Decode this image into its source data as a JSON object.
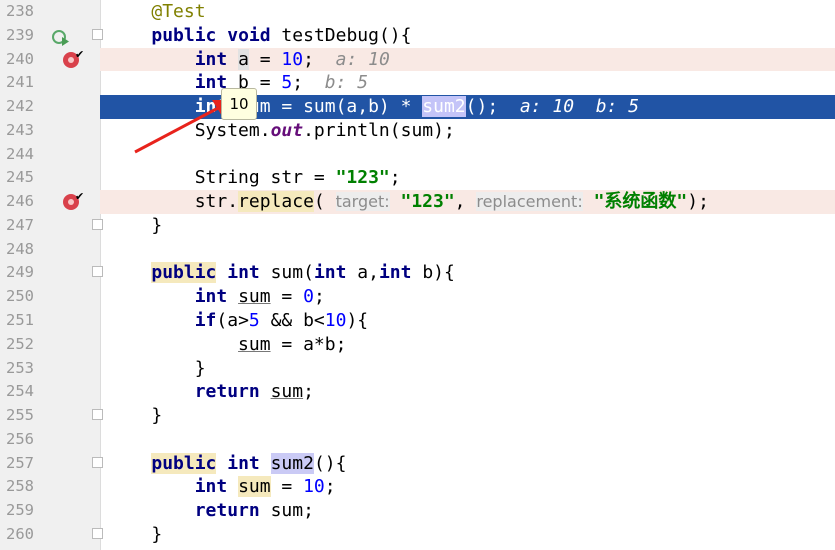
{
  "editor": {
    "lines": [
      {
        "n": "238",
        "tokens": [
          [
            "    "
          ],
          [
            "@Test",
            "ann"
          ]
        ]
      },
      {
        "n": "239",
        "tokens": [
          [
            "    "
          ],
          [
            "public",
            "kw"
          ],
          [
            " "
          ],
          [
            "void",
            "kw"
          ],
          [
            " testDebug(){"
          ]
        ],
        "run": true,
        "fold": true
      },
      {
        "n": "240",
        "bg": "pink",
        "bp": true,
        "tokens": [
          [
            "        "
          ],
          [
            "int",
            "kw"
          ],
          [
            " "
          ],
          [
            "a",
            "hg"
          ],
          [
            " = "
          ],
          [
            "10",
            "num"
          ],
          [
            ";"
          ],
          [
            "  a: 10",
            "inl"
          ]
        ]
      },
      {
        "n": "241",
        "tokens": [
          [
            "        "
          ],
          [
            "int",
            "kw"
          ],
          [
            " b = "
          ],
          [
            "5",
            "num"
          ],
          [
            ";"
          ],
          [
            "  b: 5",
            "inl"
          ]
        ]
      },
      {
        "n": "242",
        "bg": "blue",
        "tokens": [
          [
            "        "
          ],
          [
            "int",
            "kw"
          ],
          [
            " sum = sum(a,b) * "
          ],
          [
            "sum2",
            "hl"
          ],
          [
            "();"
          ],
          [
            "  a: 10  b: 5",
            "inl"
          ]
        ]
      },
      {
        "n": "243",
        "tokens": [
          [
            "        System."
          ],
          [
            "out",
            "field"
          ],
          [
            ".println(sum);"
          ]
        ]
      },
      {
        "n": "244",
        "tokens": []
      },
      {
        "n": "245",
        "tokens": [
          [
            "        String str = "
          ],
          [
            "\"123\"",
            "str"
          ],
          [
            ";"
          ]
        ]
      },
      {
        "n": "246",
        "bg": "pink",
        "bp": true,
        "tokens": [
          [
            "        str."
          ],
          [
            "replace",
            "hy"
          ],
          [
            "( "
          ],
          [
            "target:",
            "hint"
          ],
          [
            " "
          ],
          [
            "\"123\"",
            "str"
          ],
          [
            ", "
          ],
          [
            "replacement:",
            "hint"
          ],
          [
            " "
          ],
          [
            "\"系统函数\"",
            "str"
          ],
          [
            ");"
          ]
        ]
      },
      {
        "n": "247",
        "tokens": [
          [
            "    }"
          ]
        ],
        "fold": true
      },
      {
        "n": "248",
        "tokens": []
      },
      {
        "n": "249",
        "tokens": [
          [
            "    "
          ],
          [
            "public",
            "kw hy"
          ],
          [
            " "
          ],
          [
            "int",
            "kw"
          ],
          [
            " sum("
          ],
          [
            "int",
            "kw"
          ],
          [
            " a,"
          ],
          [
            "int",
            "kw"
          ],
          [
            " b){"
          ]
        ],
        "fold": true
      },
      {
        "n": "250",
        "tokens": [
          [
            "        "
          ],
          [
            "int",
            "kw"
          ],
          [
            " "
          ],
          [
            "sum",
            "ul"
          ],
          [
            " = "
          ],
          [
            "0",
            "num"
          ],
          [
            ";"
          ]
        ]
      },
      {
        "n": "251",
        "tokens": [
          [
            "        "
          ],
          [
            "if",
            "kw"
          ],
          [
            "(a>"
          ],
          [
            "5",
            "num"
          ],
          [
            " && b<"
          ],
          [
            "10",
            "num"
          ],
          [
            "){"
          ]
        ]
      },
      {
        "n": "252",
        "tokens": [
          [
            "            "
          ],
          [
            "sum",
            "ul"
          ],
          [
            " = a*b;"
          ]
        ]
      },
      {
        "n": "253",
        "tokens": [
          [
            "        }"
          ]
        ]
      },
      {
        "n": "254",
        "tokens": [
          [
            "        "
          ],
          [
            "return",
            "kw"
          ],
          [
            " "
          ],
          [
            "sum",
            "ul"
          ],
          [
            ";"
          ]
        ]
      },
      {
        "n": "255",
        "tokens": [
          [
            "    }"
          ]
        ],
        "fold": true
      },
      {
        "n": "256",
        "tokens": []
      },
      {
        "n": "257",
        "tokens": [
          [
            "    "
          ],
          [
            "public",
            "kw hy"
          ],
          [
            " "
          ],
          [
            "int",
            "kw"
          ],
          [
            " "
          ],
          [
            "sum2",
            "hl"
          ],
          [
            "(){"
          ]
        ],
        "fold": true
      },
      {
        "n": "258",
        "tokens": [
          [
            "        "
          ],
          [
            "int",
            "kw"
          ],
          [
            " "
          ],
          [
            "sum",
            "hy"
          ],
          [
            " = "
          ],
          [
            "10",
            "num"
          ],
          [
            ";"
          ]
        ]
      },
      {
        "n": "259",
        "tokens": [
          [
            "        "
          ],
          [
            "return",
            "kw"
          ],
          [
            " sum;"
          ]
        ]
      },
      {
        "n": "260",
        "tokens": [
          [
            "    }"
          ]
        ],
        "fold": true
      }
    ]
  },
  "tooltip": {
    "value": "10"
  },
  "colors": {
    "execution_line": "#2154a5",
    "breakpoint_line": "#f9e9e4",
    "breakpoint": "#d9414b",
    "annotation_arrow": "#e8231c"
  }
}
